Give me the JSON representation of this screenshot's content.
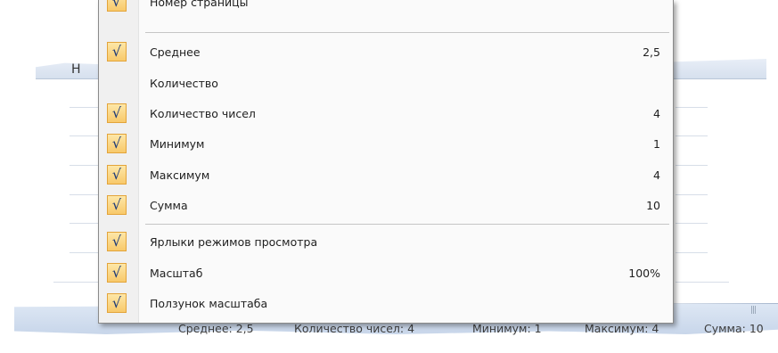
{
  "background": {
    "column_header": "Н",
    "status_bar": {
      "items": [
        "Среднее: 2,5",
        "Количество чисел: 4",
        "Минимум: 1",
        "Максимум: 4",
        "Сумма: 10"
      ]
    }
  },
  "menu": {
    "items": [
      {
        "label": "Номер страницы",
        "checked": true,
        "value": ""
      },
      {
        "label": "Среднее",
        "checked": true,
        "value": "2,5"
      },
      {
        "label": "Количество",
        "checked": false,
        "value": ""
      },
      {
        "label": "Количество чисел",
        "checked": true,
        "value": "4"
      },
      {
        "label": "Минимум",
        "checked": true,
        "value": "1"
      },
      {
        "label": "Максимум",
        "checked": true,
        "value": "4"
      },
      {
        "label": "Сумма",
        "checked": true,
        "value": "10"
      },
      {
        "label": "Ярлыки режимов просмотра",
        "checked": true,
        "value": ""
      },
      {
        "label": "Масштаб",
        "checked": true,
        "value": "100%"
      },
      {
        "label": "Ползунок масштаба",
        "checked": true,
        "value": ""
      }
    ],
    "check_glyph": "√"
  },
  "colors": {
    "check_fill": "#f8c96a",
    "check_border": "#e3a43a",
    "check_mark": "#1c3a78"
  }
}
